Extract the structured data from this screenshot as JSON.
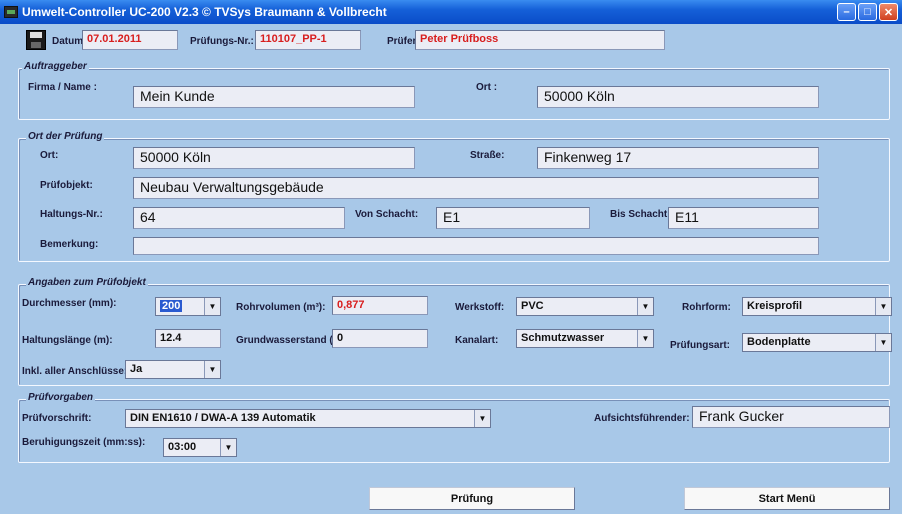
{
  "window": {
    "title": "Umwelt-Controller UC-200   V2.3  © TVSys Braumann & Vollbrecht"
  },
  "header": {
    "datum_label": "Datum:",
    "datum_value": "07.01.2011",
    "pruefungs_nr_label": "Prüfungs-Nr.:",
    "pruefungs_nr_value": "110107_PP-1",
    "pruefer_label": "Prüfer:",
    "pruefer_value": "Peter Prüfboss"
  },
  "auftraggeber": {
    "title": "Auftraggeber",
    "firma_label": "Firma / Name :",
    "firma_value": "Mein Kunde",
    "ort_label": "Ort :",
    "ort_value": "50000 Köln"
  },
  "ort_pruefung": {
    "title": "Ort der Prüfung",
    "ort_label": "Ort:",
    "ort_value": "50000 Köln",
    "strasse_label": "Straße:",
    "strasse_value": "Finkenweg 17",
    "pruefobjekt_label": "Prüfobjekt:",
    "pruefobjekt_value": "Neubau Verwaltungsgebäude",
    "haltungs_nr_label": "Haltungs-Nr.:",
    "haltungs_nr_value": "64",
    "von_schacht_label": "Von Schacht:",
    "von_schacht_value": "E1",
    "bis_schacht_label": "Bis Schacht:",
    "bis_schacht_value": "E11",
    "bemerkung_label": "Bemerkung:",
    "bemerkung_value": ""
  },
  "pruefobjekt": {
    "title": "Angaben zum Prüfobjekt",
    "durchmesser_label": "Durchmesser (mm):",
    "durchmesser_value": "200",
    "rohrvolumen_label": "Rohrvolumen (m³):",
    "rohrvolumen_value": "0,877",
    "werkstoff_label": "Werkstoff:",
    "werkstoff_value": "PVC",
    "rohrform_label": "Rohrform:",
    "rohrform_value": "Kreisprofil",
    "haltungslaenge_label": "Haltungslänge (m):",
    "haltungslaenge_value": "12.4",
    "grundwasser_label": "Grundwasserstand (m):",
    "grundwasser_value": "0",
    "kanalart_label": "Kanalart:",
    "kanalart_value": "Schmutzwasser",
    "pruefungsart_label": "Prüfungsart:",
    "pruefungsart_value": "Bodenplatte",
    "anschluesse_label": "Inkl. aller Anschlüsse:",
    "anschluesse_value": "Ja"
  },
  "pruefvorgaben": {
    "title": "Prüfvorgaben",
    "vorschrift_label": "Prüfvorschrift:",
    "vorschrift_value": "DIN EN1610 / DWA-A 139 Automatik",
    "aufsicht_label": "Aufsichtsführender:",
    "aufsicht_value": "Frank Gucker",
    "beruhigung_label": "Beruhigungszeit (mm:ss):",
    "beruhigung_value": "03:00"
  },
  "buttons": {
    "pruefung": "Prüfung",
    "start_menu": "Start Menü"
  },
  "icons": {
    "app": "app-icon",
    "save": "floppy-disk-icon",
    "dropdown": "dropdown-arrow-icon",
    "minimize": "minimize-icon",
    "maximize": "maximize-icon",
    "close": "close-icon"
  },
  "colors": {
    "background": "#a8c8e8",
    "titlebar": "#1560d8",
    "red_value": "#d81e1e"
  }
}
